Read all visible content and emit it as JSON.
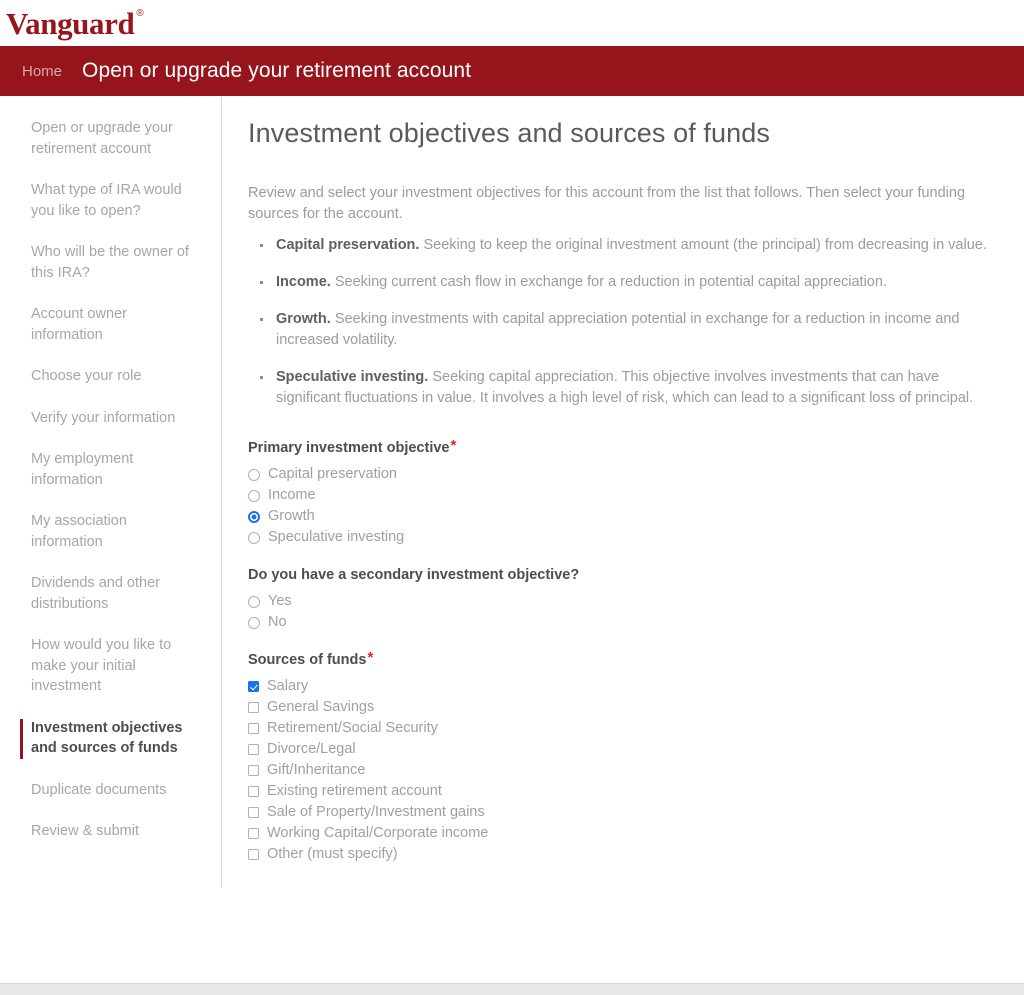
{
  "brand": {
    "logo_text": "Vanguard",
    "registered_mark": "®",
    "logo_color": "#97151c"
  },
  "header": {
    "breadcrumb_home": "Home",
    "title": "Open or upgrade your retirement account",
    "background_color": "#96151d"
  },
  "sidebar": {
    "items": [
      {
        "label": "Open or upgrade your retirement account",
        "active": false
      },
      {
        "label": "What type of IRA would you like to open?",
        "active": false
      },
      {
        "label": "Who will be the owner of this IRA?",
        "active": false
      },
      {
        "label": "Account owner information",
        "active": false
      },
      {
        "label": "Choose your role",
        "active": false
      },
      {
        "label": "Verify your information",
        "active": false
      },
      {
        "label": "My employment information",
        "active": false
      },
      {
        "label": "My association information",
        "active": false
      },
      {
        "label": "Dividends and other distributions",
        "active": false
      },
      {
        "label": "How would you like to make your initial investment",
        "active": false
      },
      {
        "label": "Investment objectives and sources of funds",
        "active": true
      },
      {
        "label": "Duplicate documents",
        "active": false
      },
      {
        "label": "Review & submit",
        "active": false
      }
    ]
  },
  "main": {
    "title": "Investment objectives and sources of funds",
    "intro": "Review and select your investment objectives for this account from the list that follows. Then select your funding sources for the account.",
    "objectives": [
      {
        "term": "Capital preservation.",
        "description": "Seeking to keep the original investment amount (the principal) from decreasing in value."
      },
      {
        "term": "Income.",
        "description": "Seeking current cash flow in exchange for a reduction in potential capital appreciation."
      },
      {
        "term": "Growth.",
        "description": "Seeking investments with capital appreciation potential in exchange for a reduction in income and increased volatility."
      },
      {
        "term": "Speculative investing.",
        "description": "Seeking capital appreciation. This objective involves investments that can have significant fluctuations in value. It involves a high level of risk, which can lead to a significant loss of principal."
      }
    ],
    "primary_objective": {
      "label": "Primary investment objective",
      "required_marker": "*",
      "options": [
        {
          "label": "Capital preservation",
          "selected": false
        },
        {
          "label": "Income",
          "selected": false
        },
        {
          "label": "Growth",
          "selected": true
        },
        {
          "label": "Speculative investing",
          "selected": false
        }
      ]
    },
    "secondary_objective": {
      "label": "Do you have a secondary investment objective?",
      "options": [
        {
          "label": "Yes",
          "selected": false
        },
        {
          "label": "No",
          "selected": false
        }
      ]
    },
    "sources_of_funds": {
      "label": "Sources of funds",
      "required_marker": "*",
      "options": [
        {
          "label": "Salary",
          "checked": true
        },
        {
          "label": "General Savings",
          "checked": false
        },
        {
          "label": "Retirement/Social Security",
          "checked": false
        },
        {
          "label": "Divorce/Legal",
          "checked": false
        },
        {
          "label": "Gift/Inheritance",
          "checked": false
        },
        {
          "label": "Existing retirement account",
          "checked": false
        },
        {
          "label": "Sale of Property/Investment gains",
          "checked": false
        },
        {
          "label": "Working Capital/Corporate income",
          "checked": false
        },
        {
          "label": "Other (must specify)",
          "checked": false
        }
      ]
    }
  },
  "colors": {
    "accent_red": "#96151d",
    "selection_blue": "#1a73e8",
    "required_red": "#e01f1f"
  }
}
